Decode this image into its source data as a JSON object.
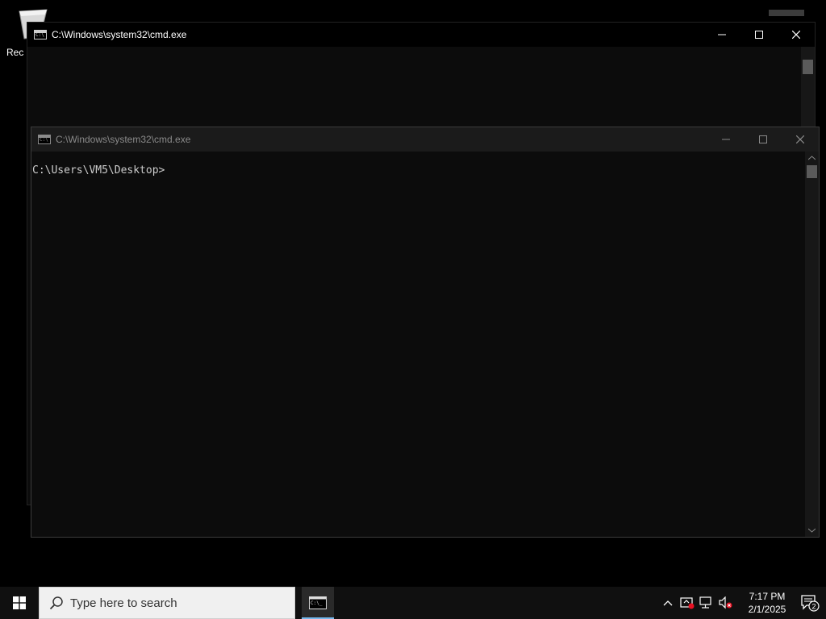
{
  "desktop": {
    "recycle_bin_label": "Rec"
  },
  "back_window": {
    "title": "C:\\Windows\\system32\\cmd.exe",
    "minimize": "—",
    "maximize": "☐",
    "close": "✕"
  },
  "front_window": {
    "title": "C:\\Windows\\system32\\cmd.exe",
    "minimize": "—",
    "maximize": "☐",
    "close": "✕",
    "console_text": "C:\\Users\\VM5\\Desktop>"
  },
  "taskbar": {
    "search_placeholder": "Type here to search",
    "pinned": [
      {
        "name": "cmd",
        "active": true
      }
    ],
    "tray": {
      "chevron": "^",
      "time": "7:17 PM",
      "date": "2/1/2025",
      "notification_count": "2"
    }
  },
  "colors": {
    "accent": "#76b9ed",
    "taskbar": "#101010",
    "console_bg": "#0c0c0c",
    "console_text": "#cccccc"
  }
}
